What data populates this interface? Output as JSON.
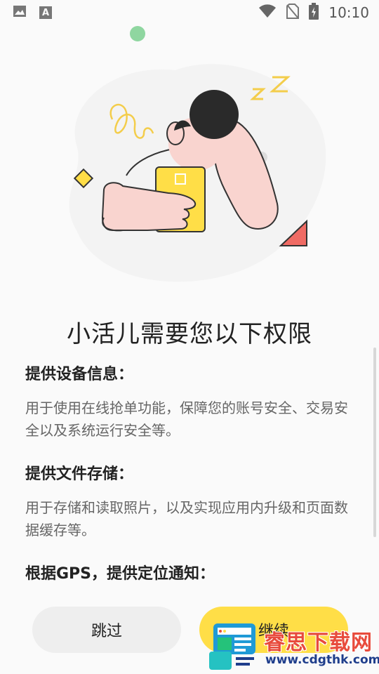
{
  "status_bar": {
    "time": "10:10",
    "icons": [
      "image-icon",
      "font-icon",
      "wifi-icon",
      "no-sim-icon",
      "battery-charging-icon"
    ],
    "font_icon_text": "A"
  },
  "title": "小活儿需要您以下权限",
  "sections": [
    {
      "heading": "提供设备信息：",
      "body": "用于使用在线抢单功能，保障您的账号安全、交易安全以及系统运行安全等。"
    },
    {
      "heading": "提供文件存储：",
      "body": "用于存储和读取照片，以及实现应用内升级和页面数据缓存等。"
    },
    {
      "heading": "根据GPS，提供定位通知：",
      "body": ""
    }
  ],
  "buttons": {
    "skip": "跳过",
    "continue": "继续"
  },
  "watermark": {
    "title": "睿思下载网",
    "url": "www.cdgthk.com"
  },
  "colors": {
    "accent_yellow": "#ffde47",
    "skin_pink": "#f9d4cf",
    "coral": "#f06b64",
    "green_dot": "#8fd6a0"
  }
}
